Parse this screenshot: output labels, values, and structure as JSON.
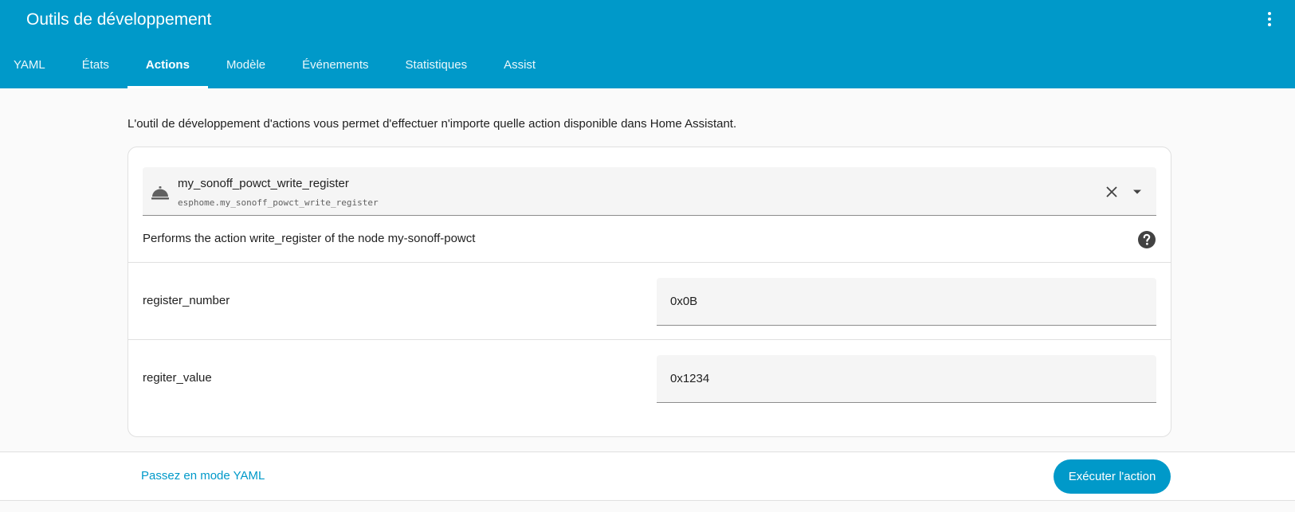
{
  "header": {
    "title": "Outils de développement",
    "menu_icon": "dots-vertical-icon"
  },
  "tabs": [
    {
      "label": "YAML",
      "active": false
    },
    {
      "label": "États",
      "active": false
    },
    {
      "label": "Actions",
      "active": true
    },
    {
      "label": "Modèle",
      "active": false
    },
    {
      "label": "Événements",
      "active": false
    },
    {
      "label": "Statistiques",
      "active": false
    },
    {
      "label": "Assist",
      "active": false
    }
  ],
  "description": "L'outil de développement d'actions vous permet d'effectuer n'importe quelle action disponible dans Home Assistant.",
  "action": {
    "name": "my_sonoff_powct_write_register",
    "id": "esphome.my_sonoff_powct_write_register",
    "icon": "room-service-icon",
    "description": "Performs the action write_register of the node my-sonoff-powct"
  },
  "fields": [
    {
      "label": "register_number",
      "value": "0x0B"
    },
    {
      "label": "regiter_value",
      "value": "0x1234"
    }
  ],
  "footer": {
    "yaml_mode_label": "Passez en mode YAML",
    "run_button_label": "Exécuter l'action"
  },
  "colors": {
    "primary": "#0099c9",
    "background": "#fafafa",
    "field_background": "#f5f5f5"
  }
}
